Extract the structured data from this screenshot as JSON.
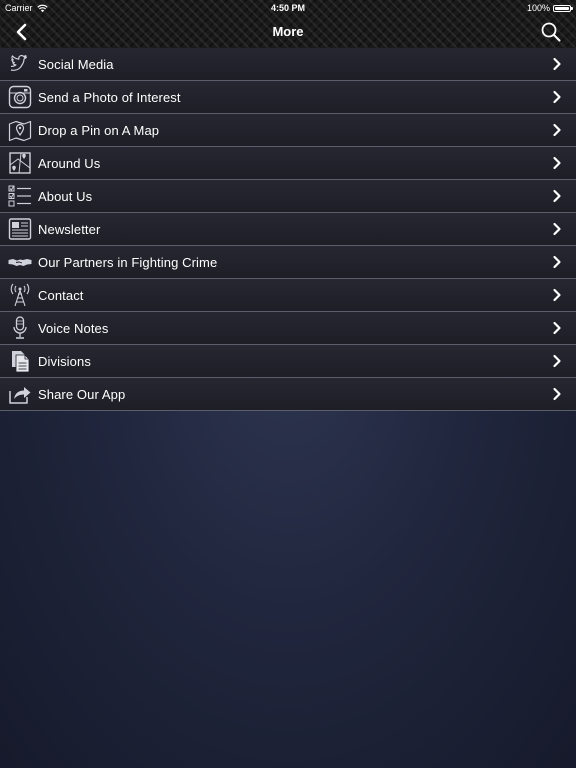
{
  "status_bar": {
    "carrier": "Carrier",
    "time": "4:50 PM",
    "battery": "100%",
    "battery_level": 1.0
  },
  "nav": {
    "title": "More",
    "back_icon": "chevron-left-icon",
    "search_icon": "search-icon"
  },
  "menu": {
    "items": [
      {
        "label": "Social Media",
        "icon": "twitter-bird-icon"
      },
      {
        "label": "Send a Photo of Interest",
        "icon": "camera-icon"
      },
      {
        "label": "Drop a Pin on A Map",
        "icon": "map-pin-icon"
      },
      {
        "label": "Around Us",
        "icon": "map-icon"
      },
      {
        "label": "About Us",
        "icon": "checklist-icon"
      },
      {
        "label": "Newsletter",
        "icon": "newspaper-icon"
      },
      {
        "label": "Our Partners in Fighting Crime",
        "icon": "handshake-icon"
      },
      {
        "label": "Contact",
        "icon": "antenna-icon"
      },
      {
        "label": "Voice Notes",
        "icon": "microphone-icon"
      },
      {
        "label": "Divisions",
        "icon": "documents-icon"
      },
      {
        "label": "Share Our App",
        "icon": "share-icon"
      }
    ]
  },
  "colors": {
    "row_divider": "#5b5f6b",
    "background": "#20263d"
  }
}
